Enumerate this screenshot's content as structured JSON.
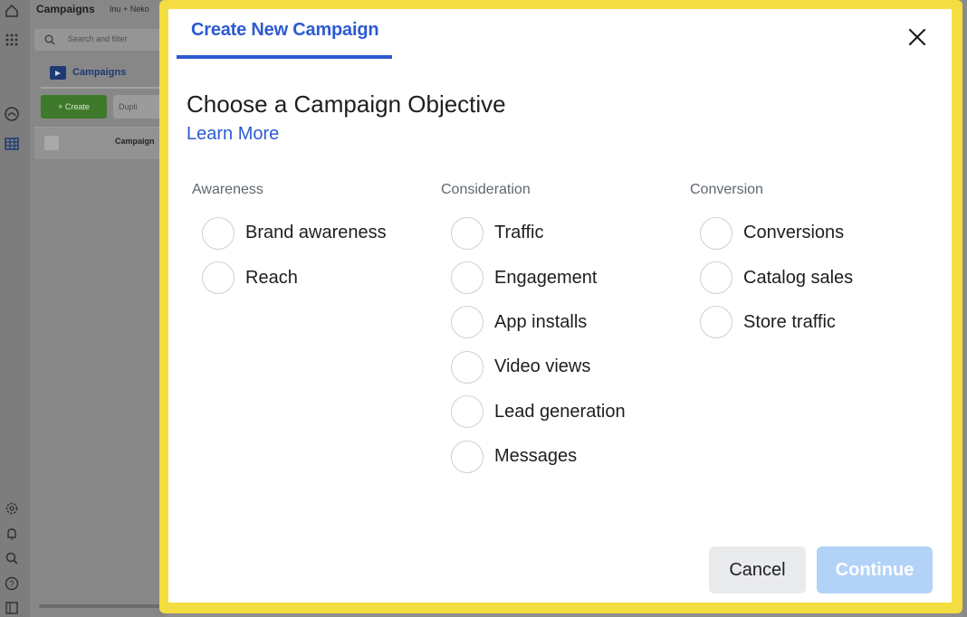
{
  "background": {
    "page_title": "Campaigns",
    "account": "Inu + Neko",
    "search_placeholder": "Search and filter",
    "tab_label": "Campaigns",
    "create_label": "+ Create",
    "duplicate_label": "Dupli",
    "column_header": "Campaign"
  },
  "modal": {
    "tab_title": "Create New Campaign",
    "heading": "Choose a Campaign Objective",
    "learn_more": "Learn More",
    "groups": [
      {
        "title": "Awareness",
        "options": [
          "Brand awareness",
          "Reach"
        ]
      },
      {
        "title": "Consideration",
        "options": [
          "Traffic",
          "Engagement",
          "App installs",
          "Video views",
          "Lead generation",
          "Messages"
        ]
      },
      {
        "title": "Conversion",
        "options": [
          "Conversions",
          "Catalog sales",
          "Store traffic"
        ]
      }
    ],
    "cancel_label": "Cancel",
    "continue_label": "Continue"
  },
  "colors": {
    "accent": "#2d5ad1",
    "highlight_border": "#f4dd40",
    "continue_disabled": "#b2d2f7",
    "create_button": "#3f7a2c"
  },
  "icons": [
    "home-icon",
    "apps-grid-icon",
    "dashboard-icon",
    "table-icon",
    "settings-icon",
    "notifications-icon",
    "search-icon",
    "help-icon",
    "close-icon",
    "folder-icon"
  ]
}
